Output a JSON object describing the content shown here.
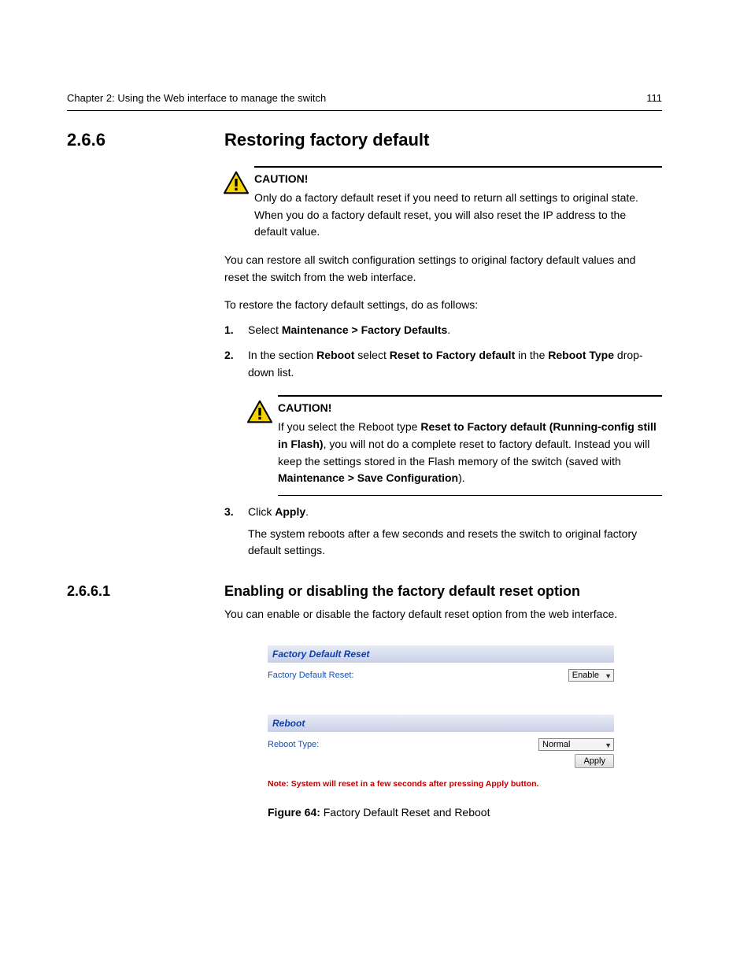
{
  "header": {
    "title": "Chapter 2: Using the Web interface to manage the switch",
    "page": "111"
  },
  "section": {
    "number": "2.6.6",
    "title": "Restoring factory default"
  },
  "caution1": {
    "label": "CAUTION!",
    "text": "Only do a factory default reset if you need to return all settings to original state. When you do a factory default reset, you will also reset the IP address to the default value."
  },
  "body1": "You can restore all switch configuration settings to original factory default values and reset the switch from the web interface.",
  "body2": "To restore the factory default settings, do as follows:",
  "steps": [
    {
      "num": "1.",
      "pre": "Select ",
      "bold1": "Maintenance > Factory Defaults",
      "post": "."
    },
    {
      "num": "2.",
      "pre": "In the section ",
      "bold1": "Reboot",
      "mid": " select ",
      "bold2": "Reset to Factory default",
      "mid2": " in the ",
      "bold3": "Reboot Type",
      "post": " drop-down list."
    }
  ],
  "caution2": {
    "label": "CAUTION!",
    "text1": "If you select the Reboot type ",
    "bold1": "Reset to Factory default (Running-config still in Flash)",
    "text2": ", you will not do a complete reset to factory default. Instead you will keep the settings stored in the Flash memory of the switch (saved with ",
    "bold2": "Maintenance > Save Configuration",
    "text3": ")."
  },
  "step3": {
    "num": "3.",
    "pre": "Click ",
    "bold1": "Apply",
    "post": "."
  },
  "result": "The system reboots after a few seconds and resets the switch to original factory default settings.",
  "subsection": {
    "number": "2.6.6.1",
    "title": "Enabling or disabling the factory default reset option"
  },
  "sub_body": "You can enable or disable the factory default reset option from the web interface.",
  "ui": {
    "section1_title": "Factory Default Reset",
    "row1_label": "Factory Default Reset:",
    "row1_value": "Enable",
    "section2_title": "Reboot",
    "row2_label": "Reboot Type:",
    "row2_value": "Normal",
    "apply_label": "Apply",
    "note": "Note: System will reset in a few seconds after pressing Apply button."
  },
  "figure": {
    "bold": "Figure 64:",
    "caption": " Factory Default Reset and Reboot"
  }
}
